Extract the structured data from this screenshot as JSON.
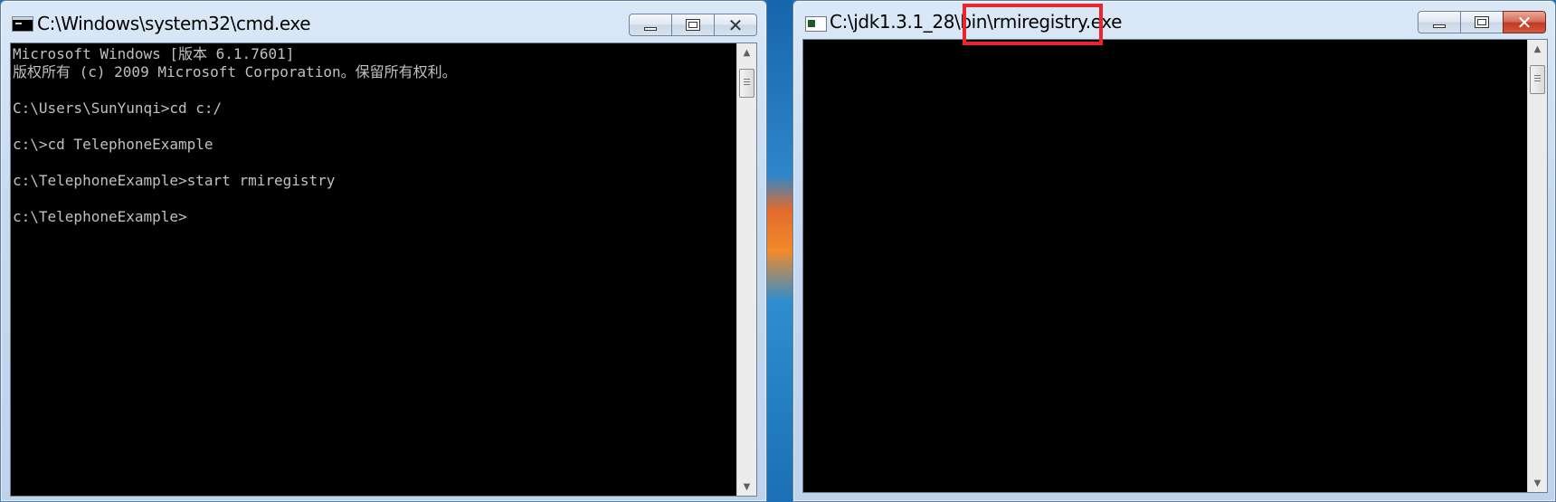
{
  "cmd_window": {
    "title": "C:\\Windows\\system32\\cmd.exe",
    "console_lines": [
      "Microsoft Windows [版本 6.1.7601]",
      "版权所有 (c) 2009 Microsoft Corporation。保留所有权利。",
      "",
      "C:\\Users\\SunYunqi>cd c:/",
      "",
      "c:\\>cd TelephoneExample",
      "",
      "c:\\TelephoneExample>start rmiregistry",
      "",
      "c:\\TelephoneExample>"
    ],
    "buttons": {
      "minimize": "",
      "maximize": "",
      "close": "✕"
    }
  },
  "rmi_window": {
    "title": "C:\\jdk1.3.1_28\\bin\\rmiregistry.exe",
    "console_lines": [],
    "buttons": {
      "minimize": "",
      "maximize": "",
      "close": "✕"
    }
  },
  "annotation": {
    "color": "#e8262c"
  },
  "colors": {
    "console_bg": "#000000",
    "console_fg": "#c0c0c0",
    "close_red": "#c23a23"
  }
}
